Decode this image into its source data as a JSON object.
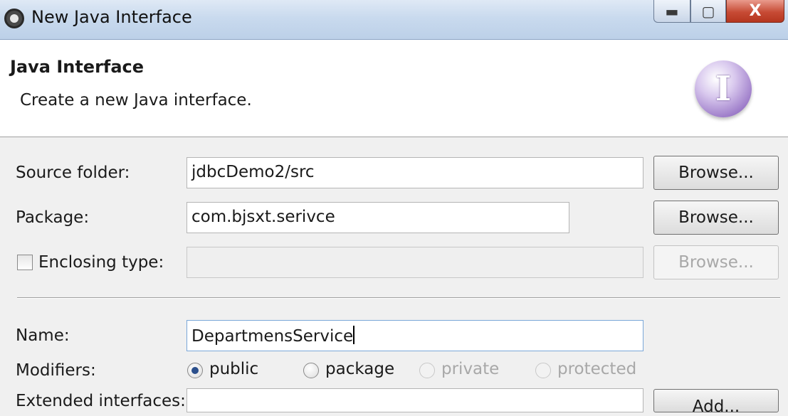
{
  "window": {
    "title": "New Java Interface",
    "controls": {
      "minimize": "▬",
      "maximize": "▢",
      "close": "X"
    }
  },
  "header": {
    "title": "Java Interface",
    "description": "Create a new Java interface.",
    "icon": "I"
  },
  "form": {
    "source_folder": {
      "label": "Source folder:",
      "value": "jdbcDemo2/src",
      "button": "Browse..."
    },
    "package": {
      "label": "Package:",
      "value": "com.bjsxt.serivce",
      "button": "Browse..."
    },
    "enclosing_type": {
      "label": "Enclosing type:",
      "value": "",
      "checked": false,
      "button": "Browse..."
    },
    "name": {
      "label": "Name:",
      "value": "DepartmensService"
    },
    "modifiers": {
      "label": "Modifiers:",
      "options": [
        {
          "label": "public",
          "checked": true,
          "enabled": true
        },
        {
          "label": "package",
          "checked": false,
          "enabled": true
        },
        {
          "label": "private",
          "checked": false,
          "enabled": false
        },
        {
          "label": "protected",
          "checked": false,
          "enabled": false
        }
      ]
    },
    "extended_interfaces": {
      "label": "Extended interfaces:",
      "button": "Add..."
    }
  }
}
